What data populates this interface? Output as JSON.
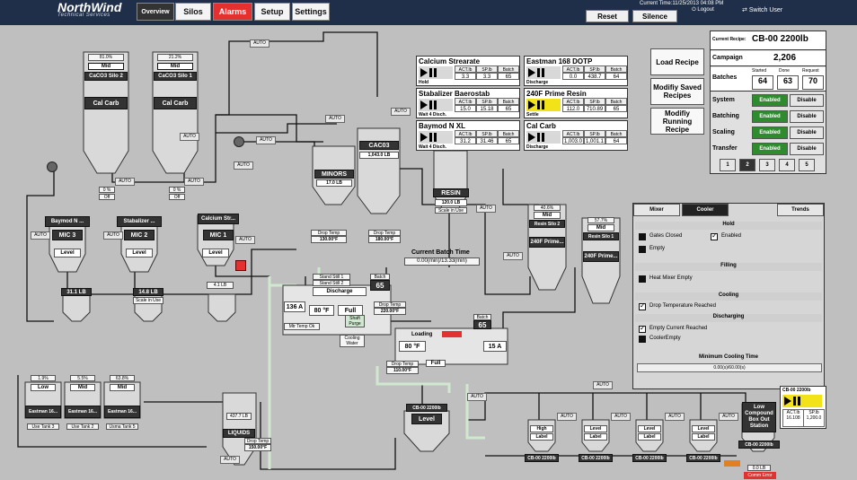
{
  "header": {
    "logo": {
      "name": "NorthWind",
      "subtitle": "Technical Services"
    },
    "nav": [
      {
        "label": "Overview",
        "state": "selected"
      },
      {
        "label": "Silos",
        "state": "normal"
      },
      {
        "label": "Alarms",
        "state": "alarm"
      },
      {
        "label": "Setup",
        "state": "normal"
      },
      {
        "label": "Settings",
        "state": "normal"
      }
    ],
    "current_time": "Current Time:11/25/2013 04:08 PM",
    "logout": "Logout",
    "switch_user": "Switch User",
    "reset": "Reset",
    "silence": "Silence"
  },
  "silos_top": [
    {
      "pct": "81.0%",
      "level": "Mid",
      "name": "CaCO3 Silo 2",
      "material": "Cal Carb",
      "vfd": "0 %",
      "vfd_status": "Off"
    },
    {
      "pct": "21.2%",
      "level": "Mid",
      "name": "CaCO3 Silo 1",
      "material": "Cal Carb",
      "vfd": "0 %",
      "vfd_status": "Off"
    }
  ],
  "minor_bins": [
    {
      "name": "Baymod N ...",
      "mic": "MIC 3",
      "level": "Level",
      "weight": "31.1 LB"
    },
    {
      "name": "Stabalizer ...",
      "mic": "MIC 2",
      "level": "Level",
      "weight": "14.8 LB",
      "status": "Scale in Use"
    },
    {
      "name": "Calcium Str...",
      "mic": "MIC 1",
      "level": "Level",
      "weight": "4.1 LB"
    }
  ],
  "materials": [
    {
      "name": "Calcium Strearate",
      "act": "3.3",
      "sp": "3.3",
      "batch": "65",
      "status": "Hold",
      "ctrl": "grey"
    },
    {
      "name": "Eastman 168 DOTP",
      "act": "0.0",
      "sp": "438.7",
      "batch": "64",
      "status": "Discharge",
      "ctrl": "grey"
    },
    {
      "name": "Stabalizer Baerostab",
      "act": "15.0",
      "sp": "15.18",
      "batch": "65",
      "status": "Wait 4 Disch.",
      "ctrl": "grey"
    },
    {
      "name": "240F Prime Resin",
      "act": "112.0",
      "sp": "710.89",
      "batch": "65",
      "status": "Settle",
      "ctrl": "yellow"
    },
    {
      "name": "Baymod N XL",
      "act": "31.2",
      "sp": "31.46",
      "batch": "65",
      "status": "Wait 4 Disch.",
      "ctrl": "grey"
    },
    {
      "name": "Cal Carb",
      "act": "1,003.0",
      "sp": "1,001.1",
      "batch": "64",
      "status": "Discharge",
      "ctrl": "grey"
    }
  ],
  "material_headers": {
    "act": "ACT.lb",
    "sp": "SP.lb",
    "batch": "Batch"
  },
  "recipe_buttons": [
    "Load Recipe",
    "Modifiy Saved Recipes",
    "Modifiy Running Recipe"
  ],
  "recipe": {
    "current_label": "Current Recipe:",
    "current": "CB-00 2200lb",
    "campaign_label": "Campaign",
    "campaign": "2,206",
    "batches_label": "Batches",
    "started_label": "Started",
    "started": "64",
    "done_label": "Done",
    "done": "63",
    "request_label": "Request",
    "request": "70",
    "rows": [
      {
        "label": "System",
        "enabled": "Enabled",
        "disable": "Disable"
      },
      {
        "label": "Batching",
        "enabled": "Enabled",
        "disable": "Disable"
      },
      {
        "label": "Scaling",
        "enabled": "Enabled",
        "disable": "Disable"
      },
      {
        "label": "Transfer",
        "enabled": "Enabled",
        "disable": "Disable"
      }
    ],
    "pages": [
      "1",
      "2",
      "3",
      "4",
      "5"
    ]
  },
  "cooler_panel": {
    "tabs": [
      "Mixer",
      "Cooler",
      "Trends"
    ],
    "hold": "Hold",
    "gates_closed": "Gates Closed",
    "enabled": "Enabled",
    "empty": "Empty",
    "filling": "Filling",
    "heat_mixer_empty": "Heat Mixer Empty",
    "cooling": "Cooling",
    "drop_temp_reached": "Drop Temperature Reached",
    "discharging": "Discharging",
    "empty_current_reached": "Empty Current Reached",
    "cooler_empty": "CoolerEmpty",
    "min_cooling_time": "Minimum Cooling Time",
    "timer": "0.00(s)/60.00(s)"
  },
  "process": {
    "minors": "MINORS",
    "minors_weight": "17.0 LB",
    "caco3": "CAC03",
    "caco3_weight": "1,043.0 LB",
    "resin": "RESIN",
    "resin_weight": "120.0 LB",
    "resin_status": "Scale in Use",
    "drop_temp_label": "Drop Temp",
    "drop_temp_1": "130.00°F",
    "drop_temp_2": "180.00°F",
    "batch_time_label": "Current Batch Time",
    "batch_time": "0.00(min)/13.33(min)",
    "discharge": "Discharge",
    "batch_label": "Batch",
    "batch_1": "65",
    "batch_2": "65",
    "mixer_amps": "136 A",
    "mixer_temp": "80 °F",
    "full": "Full",
    "mixer_temp_ok": "Mtr Temp Ok",
    "shaft_purge": "Shaft Purge",
    "cooling_water": "Cooling Water",
    "drop_temp_3": "220.00°F",
    "loading": "Loading",
    "cooler_temp": "80 °F",
    "cooler_amps": "15 A",
    "drop_temp_4": "110.00°F",
    "stand_still_1": "Stand Still 1",
    "stand_still_2": "Stand Still 2"
  },
  "resin_silos": [
    {
      "pct": "40.6%",
      "level": "Mid",
      "name": "Resin Silo 2",
      "material": "240F Prime..."
    },
    {
      "pct": "57.7%",
      "level": "Mid",
      "name": "Resin Silo 1",
      "material": "240F Prime..."
    }
  ],
  "liquid_tanks": [
    {
      "pct": "1.9%",
      "level": "Low",
      "name": "Eastman 16...",
      "use": "Use Tank 3"
    },
    {
      "pct": "5.5%",
      "level": "Mid",
      "name": "Eastman 16...",
      "use": "Use Tank 2"
    },
    {
      "pct": "63.8%",
      "level": "Mid",
      "name": "Eastman 16...",
      "use": "Usma Tank 5"
    }
  ],
  "liquids": {
    "weight": "437.7 LB",
    "name": "LIQUIDS",
    "drop_temp": "150.00°F"
  },
  "surge": {
    "recipe": "CB-00 2200lb",
    "level": "Level"
  },
  "boxes": [
    {
      "level": "High",
      "label": "Label",
      "recipe": "CB-00 2200lb"
    },
    {
      "level": "Level",
      "label": "Label",
      "recipe": "CB-00 2200lb"
    },
    {
      "level": "Level",
      "label": "Label",
      "recipe": "CB-00 2200lb"
    },
    {
      "level": "Level",
      "label": "Label",
      "recipe": "CB-00 2200lb"
    }
  ],
  "boxout": {
    "recipe": "CB-00 2200lb",
    "title": "Low Compound Box Out Station",
    "act": "16.108",
    "sp": "1,200.0",
    "station_recipe": "CB-00 2200lb",
    "weight": "0.0 LB",
    "alarm": "Comm Error"
  },
  "auto_label": "AUTO",
  "colors": {
    "green": "#2e8b2e",
    "alarm": "#e53030",
    "header": "#1f2f4a",
    "pipe_light": "#cfe8cf"
  }
}
